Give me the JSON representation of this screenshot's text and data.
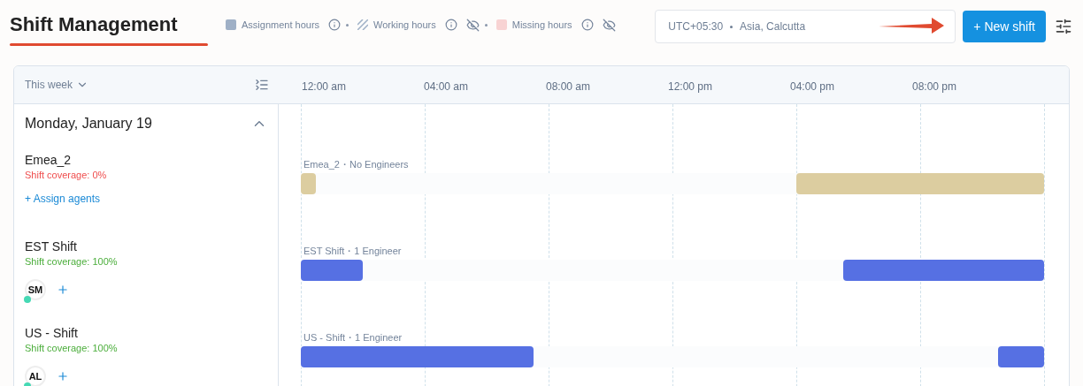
{
  "title": "Shift Management",
  "legend": [
    {
      "kind": "solid",
      "label": "Assignment hours",
      "color": "#9fb0c6",
      "hidden_toggle": false
    },
    {
      "kind": "hatched",
      "label": "Working hours",
      "color": "#9fb0c6",
      "hidden_toggle": true
    },
    {
      "kind": "solid",
      "label": "Missing hours",
      "color": "#f8d3d3",
      "hidden_toggle": true
    }
  ],
  "timezone": {
    "offset": "UTC+05:30",
    "zone": "Asia, Calcutta"
  },
  "new_shift_button": "+ New shift",
  "range_selector": "This week",
  "hours": [
    "12:00 am",
    "04:00 am",
    "08:00 am",
    "12:00 pm",
    "04:00 pm",
    "08:00 pm"
  ],
  "day": {
    "label": "Monday, January 19",
    "expanded": true
  },
  "shifts": [
    {
      "name": "Emea_2",
      "coverage": "Shift coverage: 0%",
      "covered": false,
      "assign_label": "+ Assign agents",
      "bar_label": "Emea_2・No Engineers",
      "color": "#dccda0",
      "segments": [
        {
          "level": 0.0208
        },
        {
          "level": 0.3333
        }
      ]
    },
    {
      "name": "EST Shift",
      "coverage": "Shift coverage: 100%",
      "covered": true,
      "agents": [
        {
          "initials": "SM",
          "online": true
        }
      ],
      "bar_label": "EST Shift・1 Engineer",
      "color": "#5670e3",
      "segments": [
        {
          "level": 0.0833
        },
        {
          "level": 0.2708
        }
      ]
    },
    {
      "name": "US - Shift",
      "coverage": "Shift coverage: 100%",
      "covered": true,
      "agents": [
        {
          "initials": "AL",
          "online": true
        }
      ],
      "bar_label": "US - Shift・1 Engineer",
      "color": "#5670e3",
      "segments": [
        {
          "level": 0.3125
        },
        {
          "level": 0.0625
        }
      ]
    }
  ]
}
